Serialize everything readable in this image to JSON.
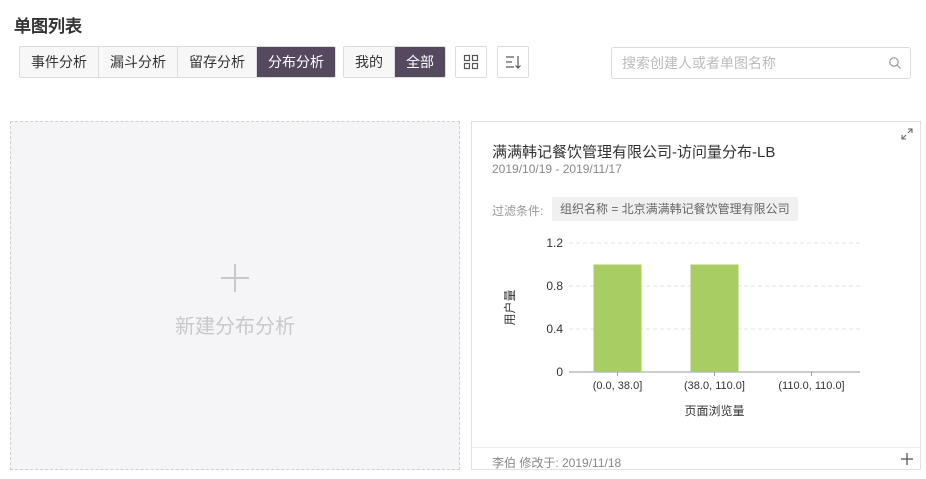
{
  "page_title": "单图列表",
  "type_tabs": [
    "事件分析",
    "漏斗分析",
    "留存分析",
    "分布分析"
  ],
  "type_tabs_active": 3,
  "scope_tabs": [
    "我的",
    "全部"
  ],
  "scope_tabs_active": 1,
  "toolbar": {
    "grid_icon": "grid-icon",
    "sort_icon": "sort-icon"
  },
  "search": {
    "placeholder": "搜索创建人或者单图名称",
    "value": ""
  },
  "new_card": {
    "label": "新建分布分析"
  },
  "chart_card": {
    "title": "满满韩记餐饮管理有限公司-访问量分布-LB",
    "date_range": "2019/10/19 - 2019/11/17",
    "filter_label": "过滤条件:",
    "filter_value": "组织名称 = 北京满满韩记餐饮管理有限公司",
    "footer": "李伯 修改于: 2019/11/18"
  },
  "colors": {
    "accent": "#55495f",
    "bar": "#a8cd63"
  },
  "chart_data": {
    "type": "bar",
    "categories": [
      "(0.0, 38.0]",
      "(38.0, 110.0]",
      "(110.0, 110.0]"
    ],
    "values": [
      1,
      1,
      0
    ],
    "xlabel": "页面浏览量",
    "ylabel": "用户量",
    "ylim": [
      0,
      1.2
    ],
    "yticks": [
      0,
      0.4,
      0.8,
      1.2
    ],
    "ytick_labels": [
      "0",
      "0.4",
      "0.8",
      "1.2"
    ],
    "grid": true
  }
}
